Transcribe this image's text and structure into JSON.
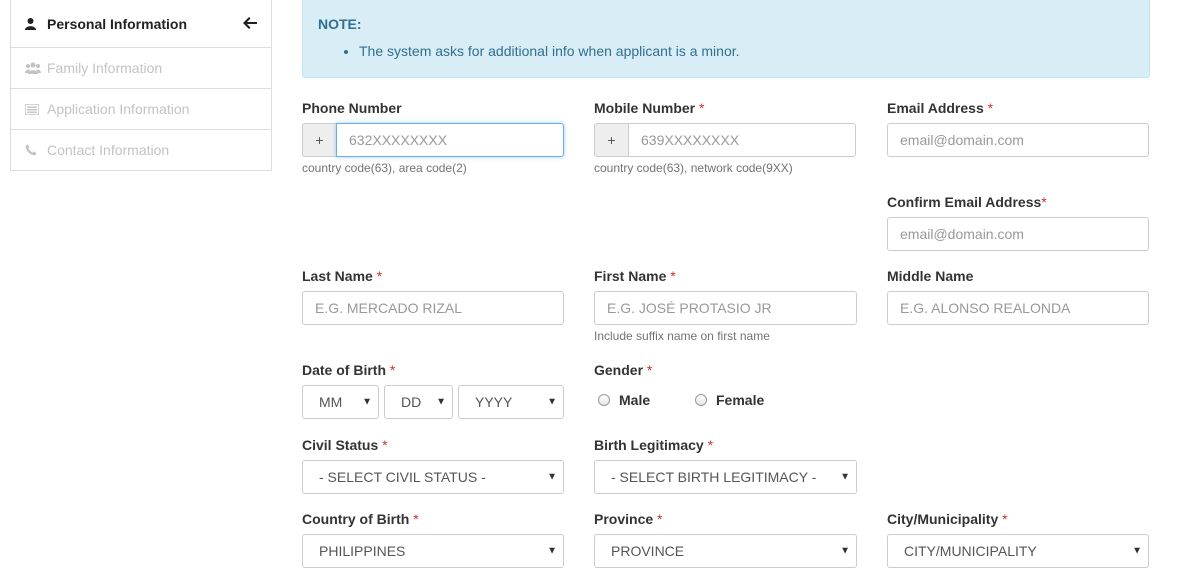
{
  "sidebar": {
    "items": [
      {
        "label": "Personal Information",
        "icon": "user-icon",
        "active": true
      },
      {
        "label": "Family Information",
        "icon": "users-icon",
        "active": false
      },
      {
        "label": "Application Information",
        "icon": "list-icon",
        "active": false
      },
      {
        "label": "Contact Information",
        "icon": "phone-icon",
        "active": false
      }
    ]
  },
  "note": {
    "title": "NOTE:",
    "items": [
      "The system asks for additional info when applicant is a minor."
    ]
  },
  "form": {
    "phone": {
      "label": "Phone Number",
      "addon": "+",
      "placeholder": "632XXXXXXXX",
      "help": "country code(63), area code(2)"
    },
    "mobile": {
      "label": "Mobile Number",
      "required": "*",
      "addon": "+",
      "placeholder": "639XXXXXXXX",
      "help": "country code(63), network code(9XX)"
    },
    "email": {
      "label": "Email Address",
      "required": "*",
      "placeholder": "email@domain.com"
    },
    "confirm_email": {
      "label": "Confirm Email Address",
      "required": "*",
      "placeholder": "email@domain.com"
    },
    "last_name": {
      "label": "Last Name",
      "required": "*",
      "placeholder": "E.G. MERCADO RIZAL"
    },
    "first_name": {
      "label": "First Name",
      "required": "*",
      "placeholder": "E.G. JOSÉ PROTASIO JR",
      "help": "Include suffix name on first name"
    },
    "middle_name": {
      "label": "Middle Name",
      "placeholder": "E.G. ALONSO REALONDA"
    },
    "dob": {
      "label": "Date of Birth",
      "required": "*",
      "month": "MM",
      "day": "DD",
      "year": "YYYY"
    },
    "gender": {
      "label": "Gender",
      "required": "*",
      "options": [
        "Male",
        "Female"
      ]
    },
    "civil_status": {
      "label": "Civil Status",
      "required": "*",
      "value": "- SELECT CIVIL STATUS -"
    },
    "birth_legitimacy": {
      "label": "Birth Legitimacy",
      "required": "*",
      "value": "- SELECT BIRTH LEGITIMACY -"
    },
    "country_of_birth": {
      "label": "Country of Birth",
      "required": "*",
      "value": "PHILIPPINES"
    },
    "province": {
      "label": "Province",
      "required": "*",
      "value": "PROVINCE"
    },
    "city": {
      "label": "City/Municipality",
      "required": "*",
      "value": "CITY/MUNICIPALITY"
    }
  },
  "colors": {
    "note_bg": "#d9edf7",
    "note_text": "#31708f",
    "required": "#c9302c",
    "focus": "#66afe9"
  }
}
